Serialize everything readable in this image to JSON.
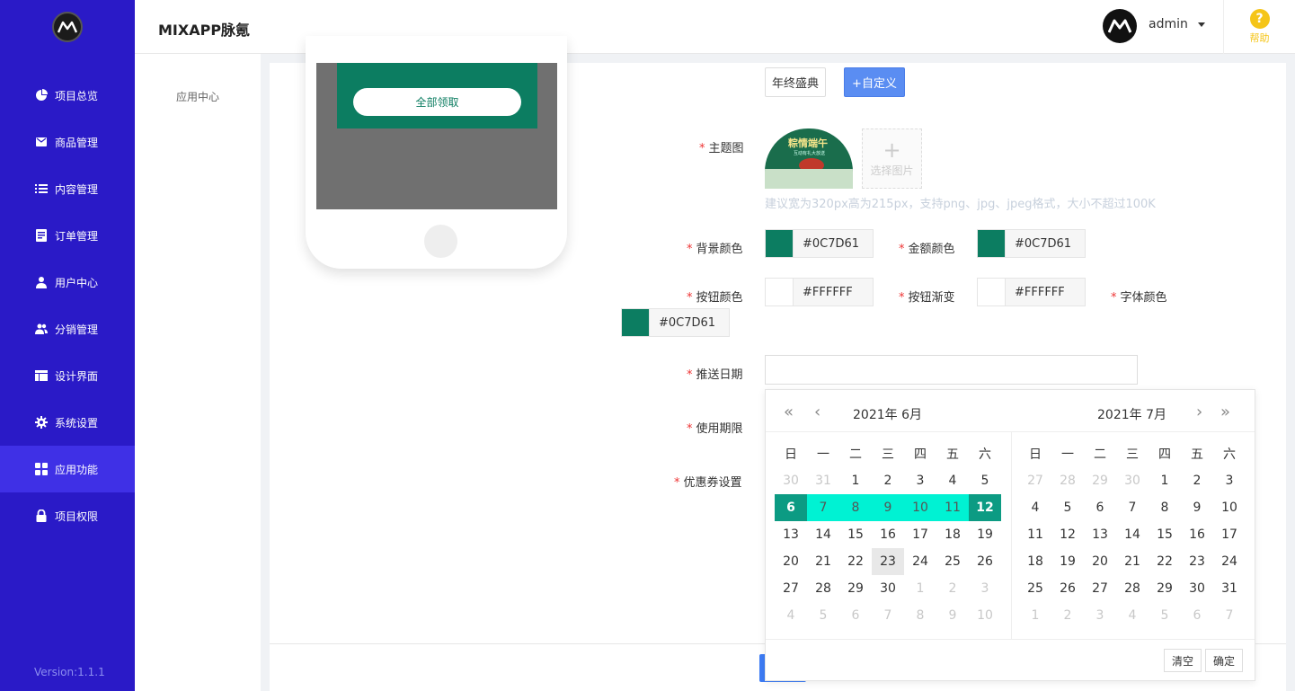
{
  "sidebar": {
    "items": [
      {
        "label": "项目总览",
        "icon": "pie-chart-icon"
      },
      {
        "label": "商品管理",
        "icon": "envelope-icon"
      },
      {
        "label": "内容管理",
        "icon": "list-icon"
      },
      {
        "label": "订单管理",
        "icon": "document-icon"
      },
      {
        "label": "用户中心",
        "icon": "user-icon"
      },
      {
        "label": "分销管理",
        "icon": "users-icon"
      },
      {
        "label": "设计界面",
        "icon": "layout-icon"
      },
      {
        "label": "系统设置",
        "icon": "gear-icon"
      },
      {
        "label": "应用功能",
        "icon": "grid-icon",
        "active": true
      },
      {
        "label": "项目权限",
        "icon": "lock-icon"
      }
    ],
    "version": "Version:1.1.1"
  },
  "header": {
    "title": "MIXAPP脉氪",
    "user": "admin",
    "help": "帮助"
  },
  "subnav": {
    "item": "应用中心"
  },
  "preview": {
    "claim_button": "全部领取"
  },
  "form": {
    "tags": {
      "preset": "年终盛典",
      "custom": "+自定义"
    },
    "theme_image_label": "主题图",
    "theme_image_title": "粽情端午",
    "theme_image_subtitle": "互动有礼大放送",
    "upload_text": "选择图片",
    "upload_plus": "+",
    "hint": "建议宽为320px高为215px，支持png、jpg、jpeg格式，大小不超过100K",
    "bg_color_label": "背景颜色",
    "bg_color": "#0C7D61",
    "amount_color_label": "金额颜色",
    "amount_color": "#0C7D61",
    "button_color_label": "按钮颜色",
    "button_color": "#FFFFFF",
    "button_gradient_label": "按钮渐变",
    "button_gradient": "#FFFFFF",
    "font_color_label": "字体颜色",
    "font_color": "#0C7D61",
    "push_date_label": "推送日期",
    "push_date_value": "",
    "validity_label": "使用期限",
    "coupon_label": "优惠券设置",
    "required_mark": "*"
  },
  "datepicker": {
    "left_title": "2021年  6月",
    "right_title": "2021年  7月",
    "weekdays": [
      "日",
      "一",
      "二",
      "三",
      "四",
      "五",
      "六"
    ],
    "left_days": [
      [
        "30",
        "31",
        "1",
        "2",
        "3",
        "4",
        "5"
      ],
      [
        "6",
        "7",
        "8",
        "9",
        "10",
        "11",
        "12"
      ],
      [
        "13",
        "14",
        "15",
        "16",
        "17",
        "18",
        "19"
      ],
      [
        "20",
        "21",
        "22",
        "23",
        "24",
        "25",
        "26"
      ],
      [
        "27",
        "28",
        "29",
        "30",
        "1",
        "2",
        "3"
      ],
      [
        "4",
        "5",
        "6",
        "7",
        "8",
        "9",
        "10"
      ]
    ],
    "right_days": [
      [
        "27",
        "28",
        "29",
        "30",
        "1",
        "2",
        "3"
      ],
      [
        "4",
        "5",
        "6",
        "7",
        "8",
        "9",
        "10"
      ],
      [
        "11",
        "12",
        "13",
        "14",
        "15",
        "16",
        "17"
      ],
      [
        "18",
        "19",
        "20",
        "21",
        "22",
        "23",
        "24"
      ],
      [
        "25",
        "26",
        "27",
        "28",
        "29",
        "30",
        "31"
      ],
      [
        "1",
        "2",
        "3",
        "4",
        "5",
        "6",
        "7"
      ]
    ],
    "selected_range": {
      "start": "6",
      "end": "12",
      "month": "6月"
    },
    "today": "23",
    "clear_label": "清空",
    "confirm_label": "确定"
  },
  "colors": {
    "sidebar_bg": "#2a1ac7",
    "sidebar_active": "#3f30e6",
    "theme_green": "#0c7d61",
    "range_cyan": "#00f2d3",
    "primary_blue": "#5a8df2",
    "help_yellow": "#f5c518"
  }
}
